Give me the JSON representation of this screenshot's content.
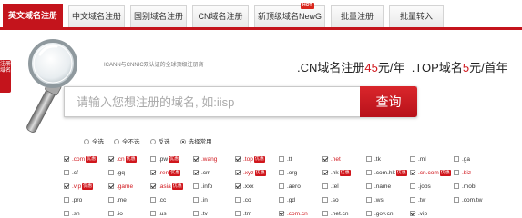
{
  "tabs": [
    "英文域名注册",
    "中文域名注册",
    "国别域名注册",
    "CN域名注册",
    "新顶级域名NewG",
    "批量注册",
    "批量转入"
  ],
  "hot_badge": "HOT",
  "side_label": "注册域名",
  "tagline": "ICANN与CNNIC双认证的全球顶级注册商",
  "promo": {
    "cn_label": ".CN域名注册",
    "cn_price": "45",
    "cn_unit": "元/年",
    "top_label": ".TOP域名",
    "top_price": "5",
    "top_unit": "元/首年"
  },
  "search": {
    "placeholder": "请输入您想注册的域名, 如:iisp",
    "button": "查询"
  },
  "radios": [
    {
      "label": "全选",
      "on": false
    },
    {
      "label": "全不选",
      "on": false
    },
    {
      "label": "反选",
      "on": false
    },
    {
      "label": "选择常用",
      "on": true
    }
  ],
  "domains": [
    [
      {
        "n": ".com",
        "c": true,
        "r": true,
        "t": "优惠"
      },
      {
        "n": ".cn",
        "c": true,
        "r": true,
        "t": "优惠"
      },
      {
        "n": ".pw",
        "c": false,
        "r": false,
        "t": "优惠"
      },
      {
        "n": ".wang",
        "c": true,
        "r": true,
        "t": ""
      },
      {
        "n": ".top",
        "c": true,
        "r": true,
        "t": "优惠"
      },
      {
        "n": ".tt",
        "c": false,
        "r": false,
        "t": ""
      },
      {
        "n": ".net",
        "c": true,
        "r": true,
        "t": ""
      },
      {
        "n": ".tk",
        "c": false,
        "r": false,
        "t": ""
      },
      {
        "n": ".ml",
        "c": false,
        "r": false,
        "t": ""
      },
      {
        "n": ".ga",
        "c": false,
        "r": false,
        "t": ""
      }
    ],
    [
      {
        "n": ".cf",
        "c": false,
        "r": false,
        "t": ""
      },
      {
        "n": ".gq",
        "c": false,
        "r": false,
        "t": ""
      },
      {
        "n": ".ren",
        "c": true,
        "r": true,
        "t": "优惠"
      },
      {
        "n": ".cm",
        "c": true,
        "r": false,
        "t": ""
      },
      {
        "n": ".xyz",
        "c": true,
        "r": true,
        "t": "优惠"
      },
      {
        "n": ".org",
        "c": false,
        "r": false,
        "t": ""
      },
      {
        "n": ".hk",
        "c": true,
        "r": false,
        "t": "优惠"
      },
      {
        "n": ".com.hk",
        "c": false,
        "r": false,
        "t": "优惠"
      },
      {
        "n": ".cn.com",
        "c": true,
        "r": true,
        "t": "优惠"
      },
      {
        "n": ".biz",
        "c": false,
        "r": true,
        "t": ""
      }
    ],
    [
      {
        "n": ".vip",
        "c": true,
        "r": true,
        "t": "优惠"
      },
      {
        "n": ".game",
        "c": true,
        "r": true,
        "t": ""
      },
      {
        "n": ".asia",
        "c": true,
        "r": true,
        "t": "优惠"
      },
      {
        "n": ".info",
        "c": false,
        "r": false,
        "t": ""
      },
      {
        "n": ".xxx",
        "c": true,
        "r": false,
        "t": ""
      },
      {
        "n": ".aero",
        "c": false,
        "r": false,
        "t": ""
      },
      {
        "n": ".tel",
        "c": false,
        "r": false,
        "t": ""
      },
      {
        "n": ".name",
        "c": false,
        "r": false,
        "t": ""
      },
      {
        "n": ".jobs",
        "c": false,
        "r": false,
        "t": ""
      },
      {
        "n": ".mobi",
        "c": false,
        "r": false,
        "t": ""
      }
    ],
    [
      {
        "n": ".pro",
        "c": false,
        "r": false,
        "t": ""
      },
      {
        "n": ".me",
        "c": false,
        "r": false,
        "t": ""
      },
      {
        "n": ".cc",
        "c": false,
        "r": false,
        "t": ""
      },
      {
        "n": ".in",
        "c": false,
        "r": false,
        "t": ""
      },
      {
        "n": ".co",
        "c": false,
        "r": false,
        "t": ""
      },
      {
        "n": ".gd",
        "c": false,
        "r": false,
        "t": ""
      },
      {
        "n": ".so",
        "c": false,
        "r": false,
        "t": ""
      },
      {
        "n": ".ws",
        "c": false,
        "r": false,
        "t": ""
      },
      {
        "n": ".tw",
        "c": false,
        "r": false,
        "t": ""
      },
      {
        "n": ".com.tw",
        "c": false,
        "r": false,
        "t": ""
      }
    ],
    [
      {
        "n": ".sh",
        "c": false,
        "r": false,
        "t": ""
      },
      {
        "n": ".io",
        "c": false,
        "r": false,
        "t": ""
      },
      {
        "n": ".us",
        "c": false,
        "r": false,
        "t": ""
      },
      {
        "n": ".tv",
        "c": false,
        "r": false,
        "t": ""
      },
      {
        "n": ".tm",
        "c": false,
        "r": false,
        "t": ""
      },
      {
        "n": ".com.cn",
        "c": true,
        "r": true,
        "t": ""
      },
      {
        "n": ".net.cn",
        "c": false,
        "r": false,
        "t": ""
      },
      {
        "n": ".gov.cn",
        "c": false,
        "r": false,
        "t": ""
      },
      {
        "n": ".vip",
        "c": true,
        "r": false,
        "t": ""
      },
      {
        "n": "",
        "c": false,
        "r": false,
        "t": ""
      }
    ]
  ]
}
